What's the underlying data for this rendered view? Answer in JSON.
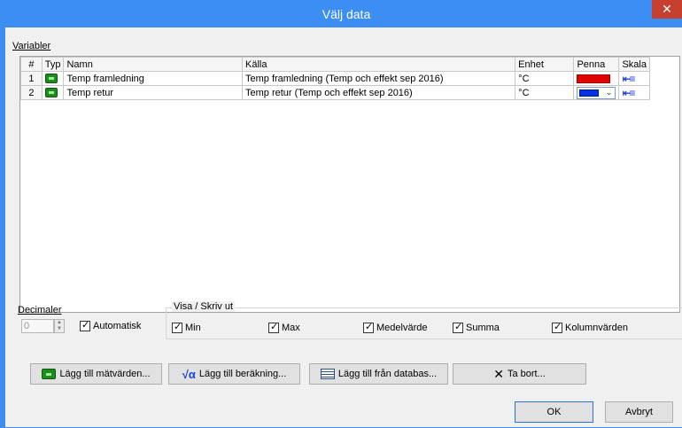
{
  "window": {
    "title": "Välj data",
    "close_label": "✕"
  },
  "variables": {
    "group_label": "Variabler",
    "columns": [
      "#",
      "Typ",
      "Namn",
      "Källa",
      "Enhet",
      "Penna",
      "Skala"
    ],
    "rows": [
      {
        "num": "1",
        "name": "Temp framledning",
        "source": "Temp framledning (Temp och effekt sep 2016)",
        "unit": "°C",
        "pen_color": "#e30000",
        "scale_icon": "scale-icon"
      },
      {
        "num": "2",
        "name": "Temp retur",
        "source": "Temp retur (Temp och effekt sep 2016)",
        "unit": "°C",
        "pen_color": "#0030e8",
        "scale_icon": "scale-icon"
      }
    ]
  },
  "decimals": {
    "label": "Decimaler",
    "value": "0",
    "auto_label": "Automatisk",
    "auto_checked": true
  },
  "show_print": {
    "label": "Visa / Skriv ut",
    "options": [
      {
        "label": "Min",
        "checked": true
      },
      {
        "label": "Max",
        "checked": true
      },
      {
        "label": "Medelvärde",
        "checked": true
      },
      {
        "label": "Summa",
        "checked": true
      },
      {
        "label": "Kolumnvärden",
        "checked": true
      }
    ]
  },
  "buttons": {
    "add_measured": "Lägg till mätvärden...",
    "add_calc": "Lägg till beräkning...",
    "add_db": "Lägg till från databas...",
    "remove": "Ta bort...",
    "ok": "OK",
    "cancel": "Avbryt"
  },
  "colors": {
    "accent": "#3c8ef3",
    "close": "#c7402f",
    "pen_red": "#e30000",
    "pen_blue": "#0030e8"
  }
}
